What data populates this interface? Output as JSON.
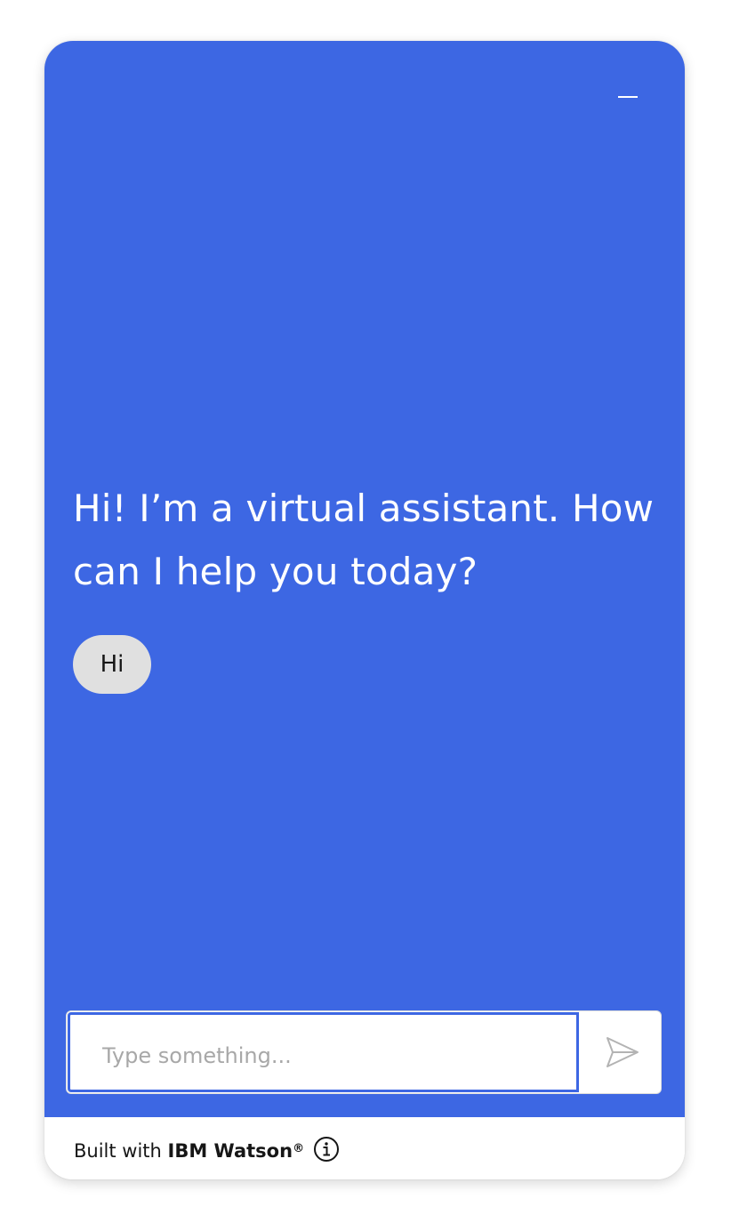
{
  "header": {
    "minimize_icon": "minimize-icon"
  },
  "conversation": {
    "greeting_line1": "Hi! I’m a virtual assistant. How",
    "greeting_line2": "can I help you today?",
    "quick_reply": "Hi"
  },
  "composer": {
    "placeholder": "Type something...",
    "value": "",
    "send_icon": "send-icon"
  },
  "footer": {
    "prefix": "Built with ",
    "brand": "IBM Watson",
    "registered": "®",
    "info_icon": "info-icon"
  },
  "colors": {
    "accent": "#3d67e3",
    "chip_background": "#e0e0e0",
    "text_dark": "#161616",
    "placeholder": "#a8a8a8"
  }
}
